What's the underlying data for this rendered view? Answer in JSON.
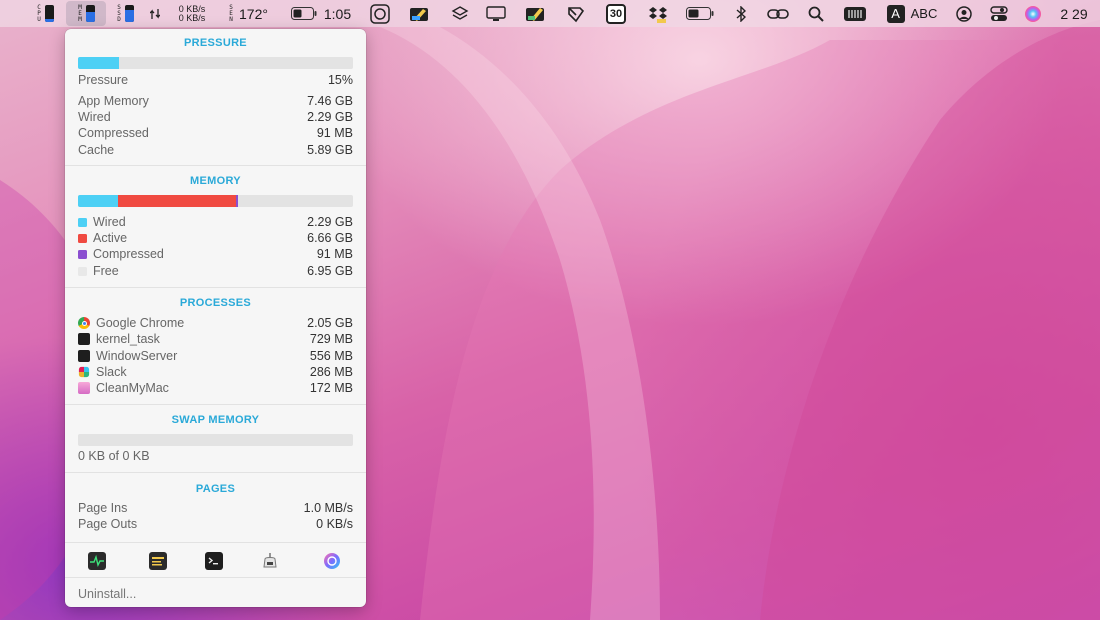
{
  "menubar": {
    "cpu_label": [
      "C",
      "P",
      "U"
    ],
    "mem_label": [
      "M",
      "E",
      "M"
    ],
    "ssd_label": [
      "S",
      "S",
      "D"
    ],
    "sen_label": [
      "S",
      "E",
      "N"
    ],
    "net_up": "0 KB/s",
    "net_down": "0 KB/s",
    "temperature": "172°",
    "time": "1:05",
    "calendar_day": "30",
    "input_letter": "A",
    "input_source": "ABC",
    "clock": "2 29",
    "cpu_level": 0.2,
    "mem_level": 0.6,
    "ssd_level": 0.7,
    "icons": [
      "cpu-meter-icon",
      "memory-meter-icon",
      "ssd-meter-icon",
      "network-arrows-icon",
      "sensors-icon",
      "battery-icon",
      "screenshot-icon",
      "color-picker-icon",
      "layers-icon",
      "display-icon",
      "ink-icon",
      "scissors-icon",
      "calendar-icon",
      "dropbox-icon",
      "battery-icon",
      "bluetooth-icon",
      "link-icon",
      "search-icon",
      "keyboard-icon",
      "input-source-icon",
      "user-icon",
      "control-center-icon",
      "siri-icon"
    ]
  },
  "popover": {
    "pressure": {
      "title": "PRESSURE",
      "level": 0.15,
      "color": "#4dd0f5",
      "pressure_label": "Pressure",
      "pressure_value": "15%",
      "rows": [
        {
          "label": "App Memory",
          "value": "7.46 GB"
        },
        {
          "label": "Wired",
          "value": "2.29 GB"
        },
        {
          "label": "Compressed",
          "value": "91 MB"
        },
        {
          "label": "Cache",
          "value": "5.89 GB"
        }
      ]
    },
    "memory": {
      "title": "MEMORY",
      "segments": [
        {
          "name": "Wired",
          "fraction": 0.147,
          "color": "#4dd0f5"
        },
        {
          "name": "Active",
          "fraction": 0.428,
          "color": "#f04a41"
        },
        {
          "name": "Compressed",
          "fraction": 0.006,
          "color": "#8b4fd0"
        }
      ],
      "rows": [
        {
          "label": "Wired",
          "value": "2.29 GB",
          "color": "#4dd0f5"
        },
        {
          "label": "Active",
          "value": "6.66 GB",
          "color": "#f04a41"
        },
        {
          "label": "Compressed",
          "value": "91 MB",
          "color": "#8b4fd0"
        },
        {
          "label": "Free",
          "value": "6.95 GB",
          "color": "#e8e8e8"
        }
      ]
    },
    "processes": {
      "title": "PROCESSES",
      "rows": [
        {
          "label": "Google Chrome",
          "value": "2.05 GB",
          "icon": "chrome-icon"
        },
        {
          "label": "kernel_task",
          "value": "729 MB",
          "icon": "terminal-icon"
        },
        {
          "label": "WindowServer",
          "value": "556 MB",
          "icon": "terminal-icon"
        },
        {
          "label": "Slack",
          "value": "286 MB",
          "icon": "slack-icon"
        },
        {
          "label": "CleanMyMac",
          "value": "172 MB",
          "icon": "cleanmymac-icon"
        }
      ]
    },
    "swap": {
      "title": "SWAP MEMORY",
      "level": 0,
      "usage_text": "0 KB of 0 KB"
    },
    "pages": {
      "title": "PAGES",
      "rows": [
        {
          "label": "Page Ins",
          "value": "1.0 MB/s"
        },
        {
          "label": "Page Outs",
          "value": "0 KB/s"
        }
      ]
    },
    "toolbar": [
      "activity-monitor-icon",
      "console-icon",
      "terminal-icon",
      "disk-utility-icon",
      "cleanmymac-icon"
    ],
    "uninstall_label": "Uninstall..."
  }
}
